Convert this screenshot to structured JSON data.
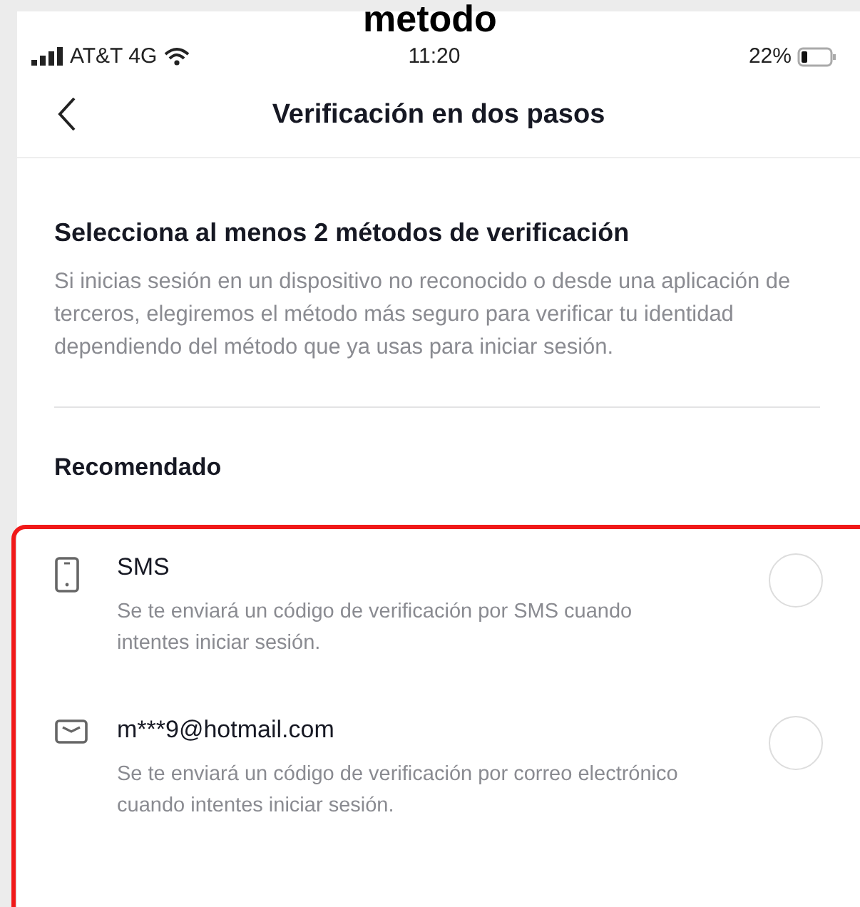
{
  "caption": "metodo",
  "status_bar": {
    "carrier": "AT&T 4G",
    "time": "11:20",
    "battery": "22%"
  },
  "nav": {
    "title": "Verificación en dos pasos"
  },
  "heading": "Selecciona al menos 2 métodos de verificación",
  "description": "Si inicias sesión en un dispositivo no reconocido o desde una aplicación de terceros, elegiremos el método más seguro para verificar tu identidad dependiendo del método que ya usas para iniciar sesión.",
  "section_label": "Recomendado",
  "methods": [
    {
      "kind": "phone",
      "title": "SMS",
      "description": "Se te enviará un código de verificación por SMS cuando intentes iniciar sesión.",
      "selected": false
    },
    {
      "kind": "email",
      "title": "m***9@hotmail.com",
      "description": "Se te enviará un código de verificación por correo electrónico cuando intentes iniciar sesión.",
      "selected": false
    }
  ]
}
